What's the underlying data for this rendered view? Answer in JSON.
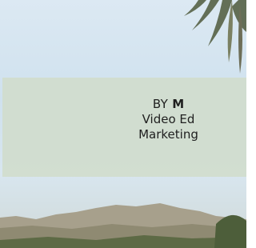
{
  "byline": {
    "prefix": "BY ",
    "author_name": "M",
    "role_line": "Video Ed",
    "department_line": "Marketing"
  },
  "colors": {
    "card_background": "#d1ddcd",
    "text": "#1f1f1f",
    "sky": "#d8e6ef"
  }
}
